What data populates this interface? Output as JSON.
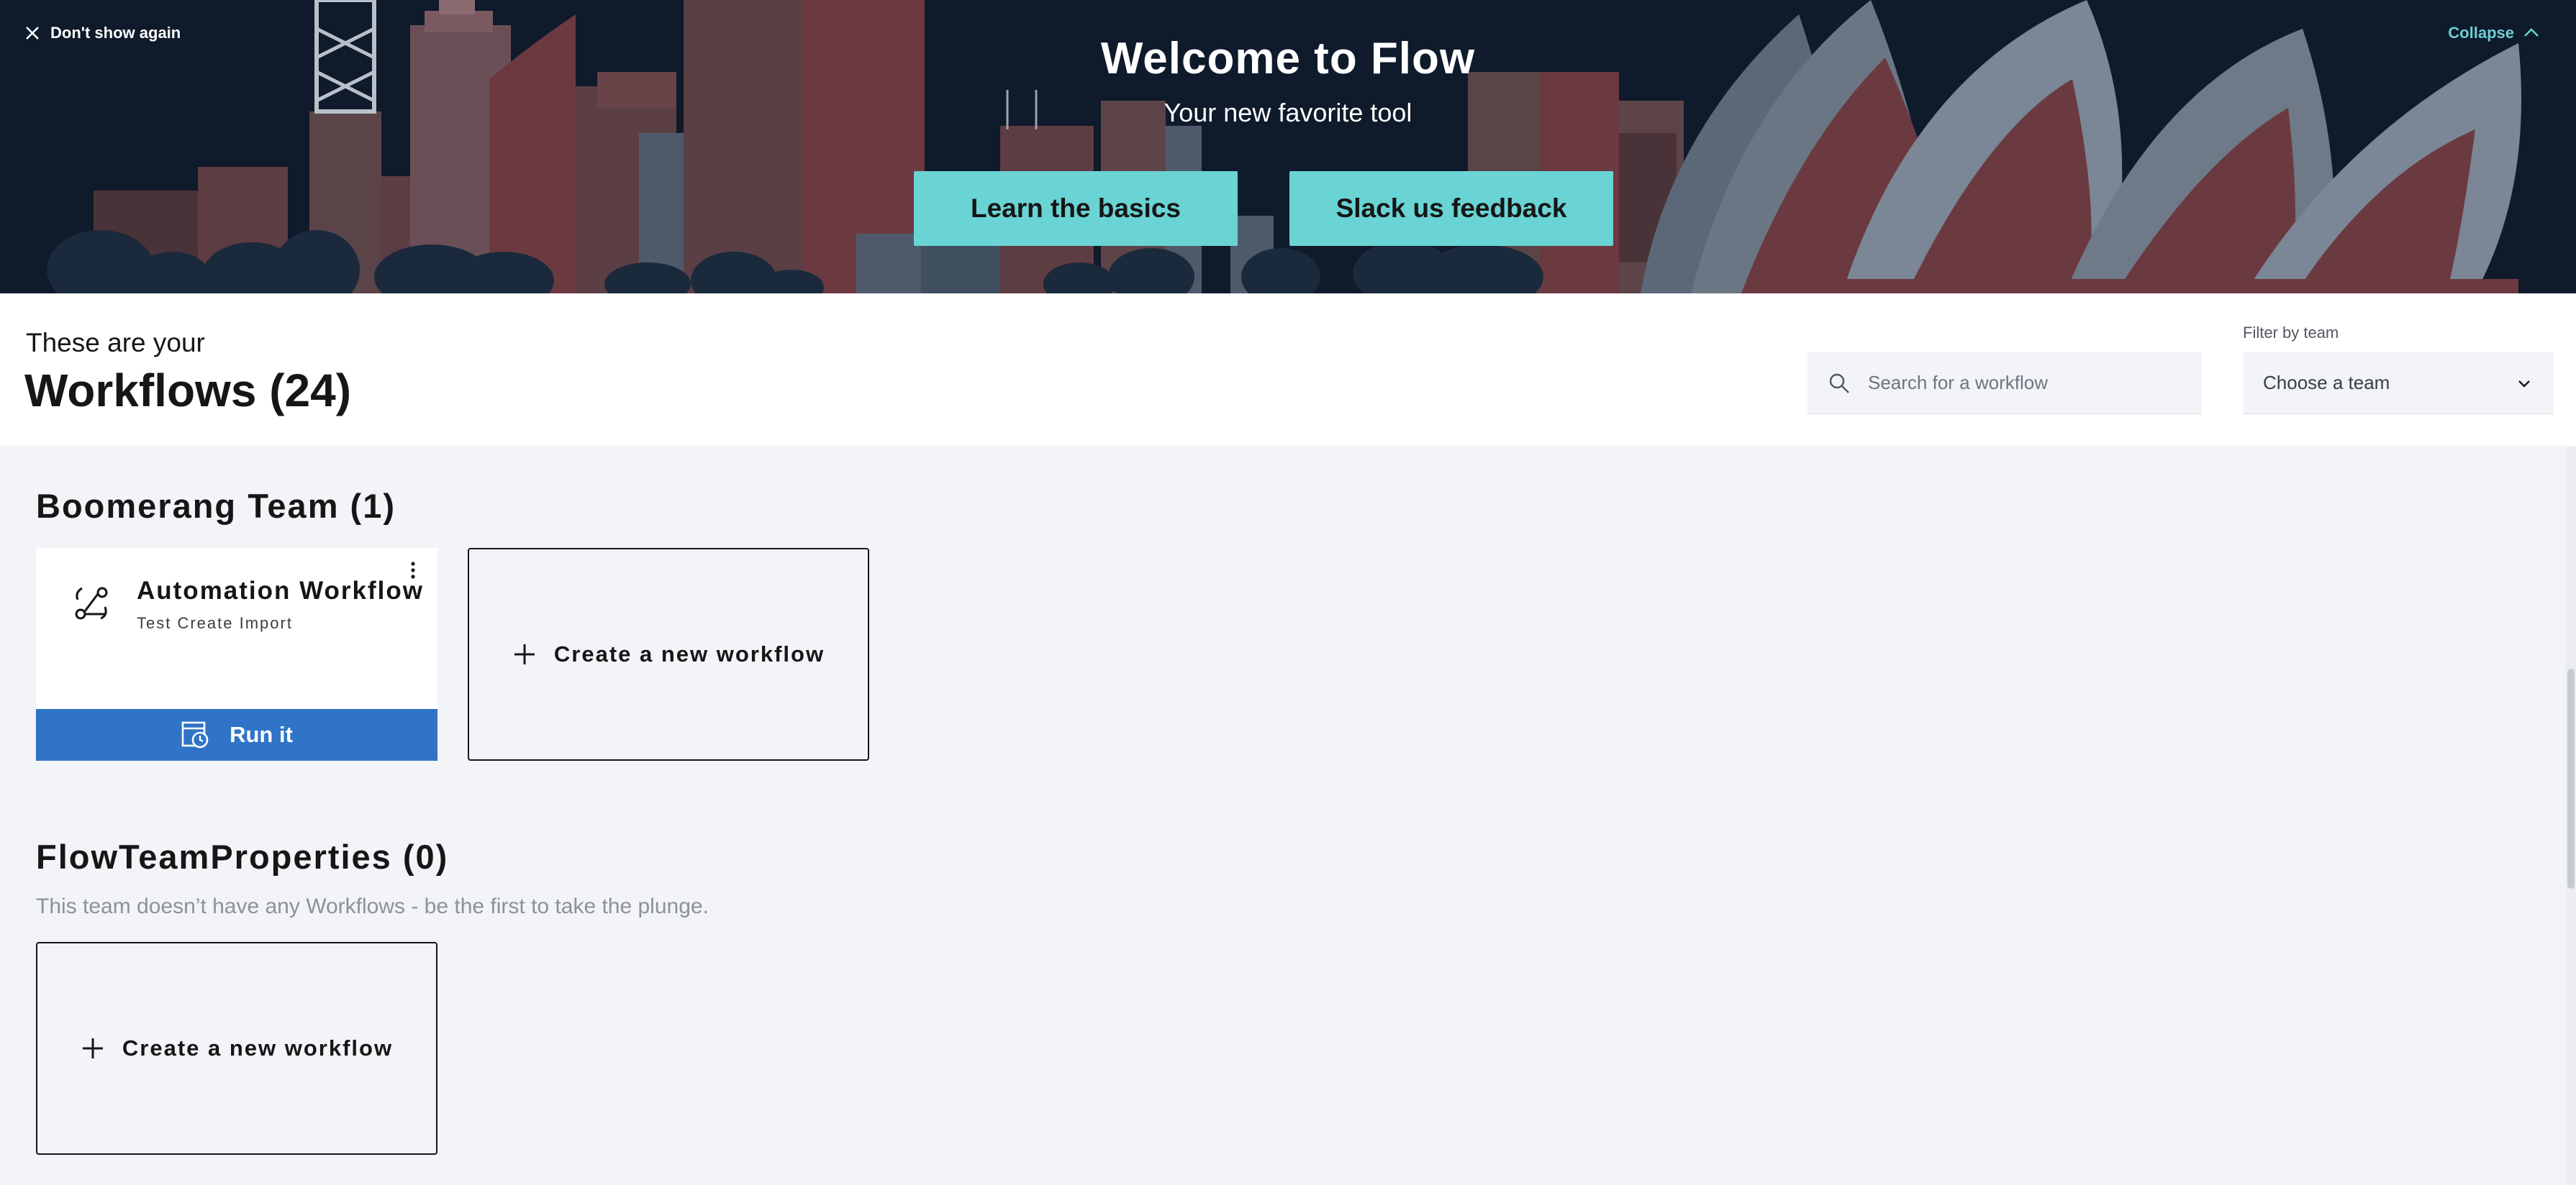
{
  "banner": {
    "dismiss_label": "Don't show again",
    "collapse_label": "Collapse",
    "title": "Welcome to Flow",
    "subtitle": "Your new favorite tool",
    "learn_button": "Learn the basics",
    "slack_button": "Slack us feedback",
    "accent_color": "#6ad3d4",
    "background_color": "#0f1a2b"
  },
  "header": {
    "kicker": "These are your",
    "title": "Workflows (24)",
    "search_placeholder": "Search for a workflow",
    "filter_label": "Filter by team",
    "filter_value": "Choose a team"
  },
  "sections": [
    {
      "title": "Boomerang Team (1)",
      "workflows": [
        {
          "name": "Automation Workflow",
          "description": "Test Create Import",
          "icon": "workflow-icon",
          "run_label": "Run it"
        }
      ],
      "create_label": "Create a new workflow"
    },
    {
      "title": "FlowTeamProperties (0)",
      "empty_message": "This team doesn’t have any Workflows - be the first to take the plunge.",
      "create_label": "Create a new workflow"
    }
  ],
  "colors": {
    "run_button": "#2f74c6",
    "page_background": "#f2f4f8"
  }
}
